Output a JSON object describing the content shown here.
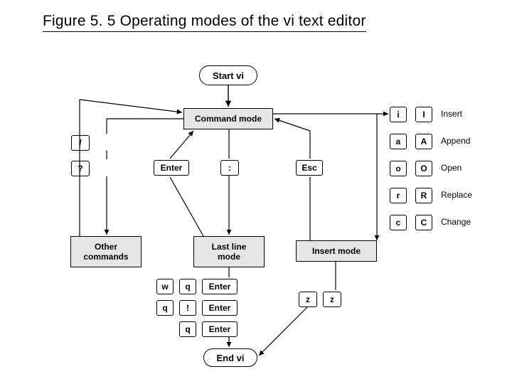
{
  "title": "Figure 5. 5  Operating modes of the vi text editor",
  "nodes": {
    "start": "Start vi",
    "command": "Command mode",
    "other": "Other\ncommands",
    "lastline": "Last line\nmode",
    "insert": "Insert mode",
    "end": "End vi"
  },
  "keys": {
    "slash": "/",
    "question": "?",
    "enter1": "Enter",
    "colon": ":",
    "esc": "Esc",
    "i_l": "i",
    "i_u": "I",
    "a_l": "a",
    "a_u": "A",
    "o_l": "o",
    "o_u": "O",
    "r_l": "r",
    "r_u": "R",
    "c_l": "c",
    "c_u": "C",
    "w": "w",
    "q1": "q",
    "enter2": "Enter",
    "q2": "q",
    "bang": "!",
    "enter3": "Enter",
    "q3": "q",
    "enter4": "Enter",
    "z1": "z",
    "z2": "z"
  },
  "labels": {
    "insert": "Insert",
    "append": "Append",
    "open": "Open",
    "replace": "Replace",
    "change": "Change"
  }
}
